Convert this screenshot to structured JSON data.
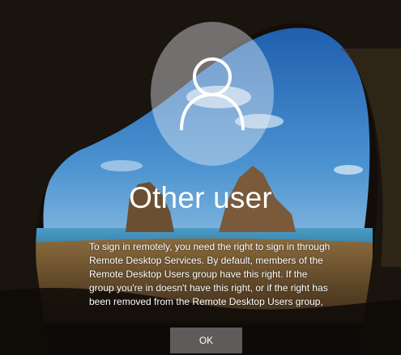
{
  "user": {
    "avatar_icon": "person-outline-icon",
    "name": "Other user"
  },
  "message": "To sign in remotely, you need the right to sign in through Remote Desktop Services. By default, members of the Remote Desktop Users group have this right. If the group you're in doesn't have this right, or if the right has been removed from the Remote Desktop Users group, you need",
  "ok_button": {
    "label": "OK"
  },
  "colors": {
    "sky": "#2d78c4",
    "sea": "#3b8fb8",
    "rock": "#1a140f"
  }
}
